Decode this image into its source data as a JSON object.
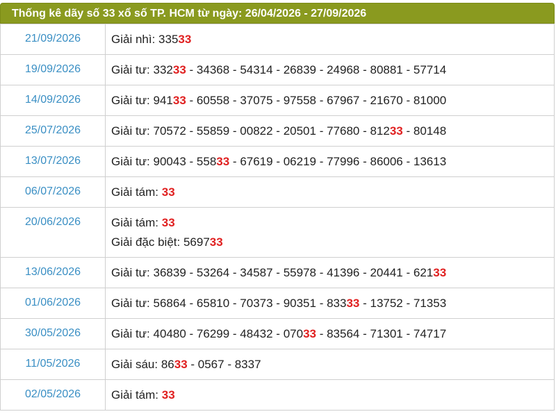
{
  "title": "Thống kê dãy số 33 xổ số TP. HCM từ ngày: 26/04/2026 - 27/09/2026",
  "highlight": "33",
  "rows": [
    {
      "date": "21/09/2026",
      "lines": [
        {
          "prize": "Giải nhì",
          "numbers": [
            "33533"
          ]
        }
      ]
    },
    {
      "date": "19/09/2026",
      "lines": [
        {
          "prize": "Giải tư",
          "numbers": [
            "33233",
            "34368",
            "54314",
            "26839",
            "24968",
            "80881",
            "57714"
          ]
        }
      ]
    },
    {
      "date": "14/09/2026",
      "lines": [
        {
          "prize": "Giải tư",
          "numbers": [
            "94133",
            "60558",
            "37075",
            "97558",
            "67967",
            "21670",
            "81000"
          ]
        }
      ]
    },
    {
      "date": "25/07/2026",
      "lines": [
        {
          "prize": "Giải tư",
          "numbers": [
            "70572",
            "55859",
            "00822",
            "20501",
            "77680",
            "81233",
            "80148"
          ]
        }
      ]
    },
    {
      "date": "13/07/2026",
      "lines": [
        {
          "prize": "Giải tư",
          "numbers": [
            "90043",
            "55833",
            "67619",
            "06219",
            "77996",
            "86006",
            "13613"
          ]
        }
      ]
    },
    {
      "date": "06/07/2026",
      "lines": [
        {
          "prize": "Giải tám",
          "numbers": [
            "33"
          ]
        }
      ]
    },
    {
      "date": "20/06/2026",
      "lines": [
        {
          "prize": "Giải tám",
          "numbers": [
            "33"
          ]
        },
        {
          "prize": "Giải đặc biệt",
          "numbers": [
            "569733"
          ]
        }
      ]
    },
    {
      "date": "13/06/2026",
      "lines": [
        {
          "prize": "Giải tư",
          "numbers": [
            "36839",
            "53264",
            "34587",
            "55978",
            "41396",
            "20441",
            "62133"
          ]
        }
      ]
    },
    {
      "date": "01/06/2026",
      "lines": [
        {
          "prize": "Giải tư",
          "numbers": [
            "56864",
            "65810",
            "70373",
            "90351",
            "83333",
            "13752",
            "71353"
          ]
        }
      ]
    },
    {
      "date": "30/05/2026",
      "lines": [
        {
          "prize": "Giải tư",
          "numbers": [
            "40480",
            "76299",
            "48432",
            "07033",
            "83564",
            "71301",
            "74717"
          ]
        }
      ]
    },
    {
      "date": "11/05/2026",
      "lines": [
        {
          "prize": "Giải sáu",
          "numbers": [
            "8633",
            "0567",
            "8337"
          ]
        }
      ]
    },
    {
      "date": "02/05/2026",
      "lines": [
        {
          "prize": "Giải tám",
          "numbers": [
            "33"
          ]
        }
      ]
    }
  ]
}
